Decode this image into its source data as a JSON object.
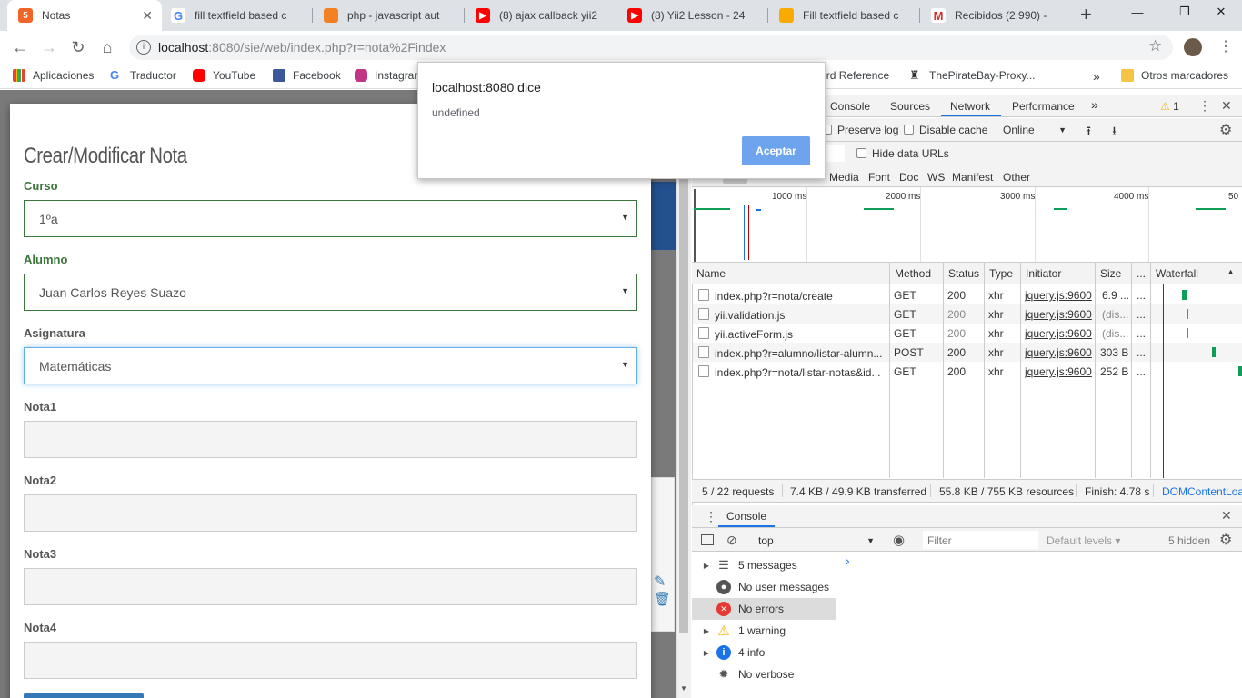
{
  "browser": {
    "tabs": [
      {
        "title": "Notas",
        "favicon_color": "#f16529"
      },
      {
        "title": "fill textfield based c",
        "favicon_color": "#4285f4"
      },
      {
        "title": "php - javascript aut",
        "favicon_color": "#f48024"
      },
      {
        "title": "(8) ajax callback yii2",
        "favicon_color": "#ff0000"
      },
      {
        "title": "(8) Yii2 Lesson - 24",
        "favicon_color": "#ff0000"
      },
      {
        "title": "Fill textfield based c",
        "favicon_color": "#f48024"
      },
      {
        "title": "Recibidos (2.990) -",
        "favicon_color": "#d93025"
      }
    ],
    "new_tab": "+",
    "url_host": "localhost",
    "url_rest": ":8080/sie/web/index.php?r=nota%2Findex",
    "bookmarks": [
      {
        "label": "Aplicaciones",
        "color": "#4285f4"
      },
      {
        "label": "Traductor",
        "color": "#4285f4"
      },
      {
        "label": "YouTube",
        "color": "#ff0000"
      },
      {
        "label": "Facebook",
        "color": "#3b5998"
      },
      {
        "label": "Instagram",
        "color": "#c13584"
      },
      {
        "label": "Word Reference",
        "color": "#555555"
      },
      {
        "label": "ThePirateBay-Proxy...",
        "color": "#333333"
      }
    ],
    "bookmarks_more": "»",
    "other_bookmarks": "Otros marcadores"
  },
  "alert": {
    "title": "localhost:8080 dice",
    "message": "undefined",
    "accept": "Aceptar"
  },
  "form": {
    "title": "Crear/Modificar Nota",
    "curso_label": "Curso",
    "curso_value": "1ºa",
    "alumno_label": "Alumno",
    "alumno_value": "Juan Carlos Reyes Suazo",
    "asignatura_label": "Asignatura",
    "asignatura_value": "Matemáticas",
    "nota1_label": "Nota1",
    "nota2_label": "Nota2",
    "nota3_label": "Nota3",
    "nota4_label": "Nota4"
  },
  "devtools": {
    "tabs": [
      "Console",
      "Sources",
      "Network",
      "Performance"
    ],
    "more_tabs": "»",
    "warning_count": "1",
    "preserve_log": "Preserve log",
    "disable_cache": "Disable cache",
    "throttle": "Online",
    "hide_data_urls": "Hide data URLs",
    "filter_types": [
      "Media",
      "Font",
      "Doc",
      "WS",
      "Manifest",
      "Other"
    ],
    "timeline_labels": [
      "1000 ms",
      "2000 ms",
      "3000 ms",
      "4000 ms",
      "50"
    ],
    "columns": [
      "Name",
      "Method",
      "Status",
      "Type",
      "Initiator",
      "Size",
      "...",
      "Waterfall"
    ],
    "rows": [
      {
        "name": "index.php?r=nota/create",
        "method": "GET",
        "status": "200",
        "type": "xhr",
        "initiator": "jquery.js:9600",
        "size": "6.9 ...",
        "extra": "..."
      },
      {
        "name": "yii.validation.js",
        "method": "GET",
        "status": "200",
        "type": "xhr",
        "initiator": "jquery.js:9600",
        "size": "(dis...",
        "extra": "..."
      },
      {
        "name": "yii.activeForm.js",
        "method": "GET",
        "status": "200",
        "type": "xhr",
        "initiator": "jquery.js:9600",
        "size": "(dis...",
        "extra": "..."
      },
      {
        "name": "index.php?r=alumno/listar-alumn...",
        "method": "POST",
        "status": "200",
        "type": "xhr",
        "initiator": "jquery.js:9600",
        "size": "303 B",
        "extra": "..."
      },
      {
        "name": "index.php?r=nota/listar-notas&id...",
        "method": "GET",
        "status": "200",
        "type": "xhr",
        "initiator": "jquery.js:9600",
        "size": "252 B",
        "extra": "..."
      }
    ],
    "status_bar": {
      "requests": "5 / 22 requests",
      "transferred": "7.4 KB / 49.9 KB transferred",
      "resources": "55.8 KB / 755 KB resources",
      "finish": "Finish: 4.78 s",
      "dom": "DOMContentLoa"
    },
    "console": {
      "tab": "Console",
      "context": "top",
      "filter_placeholder": "Filter",
      "levels": "Default levels ▾",
      "hidden": "5 hidden",
      "prompt": "›",
      "sidebar": [
        {
          "label": "5 messages",
          "icon": "list-icon"
        },
        {
          "label": "No user messages",
          "icon": "user-icon"
        },
        {
          "label": "No errors",
          "icon": "error-icon"
        },
        {
          "label": "1 warning",
          "icon": "warning-icon"
        },
        {
          "label": "4 info",
          "icon": "info-icon"
        },
        {
          "label": "No verbose",
          "icon": "bug-icon"
        }
      ]
    }
  }
}
